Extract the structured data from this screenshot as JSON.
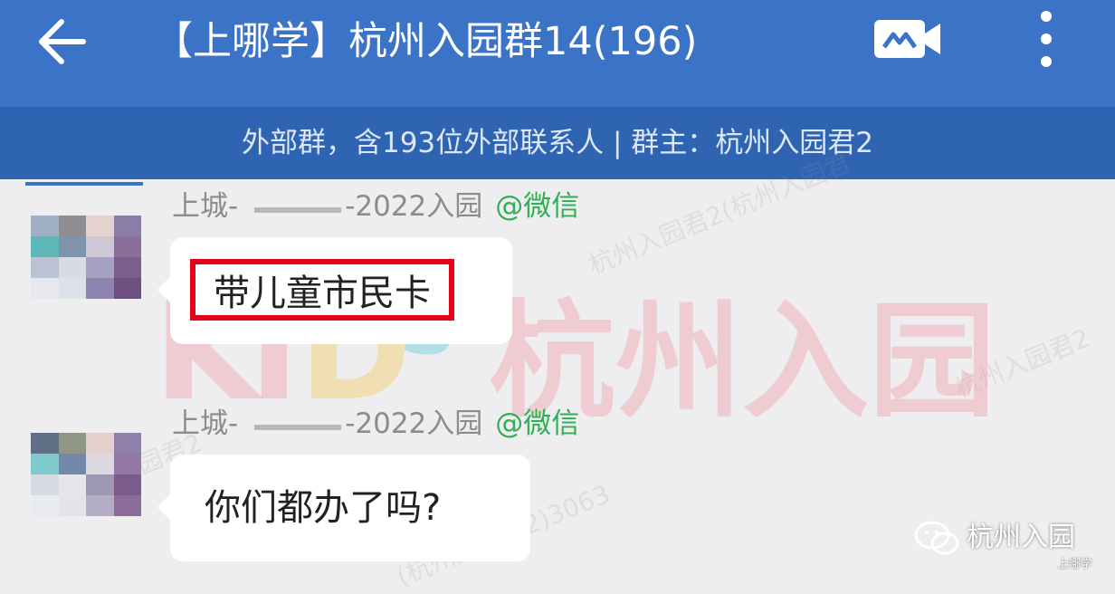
{
  "header": {
    "title": "【上哪学】杭州入园群14(196)",
    "back_icon": "arrow-left-icon",
    "video_icon": "video-call-icon",
    "more_icon": "more-vertical-icon"
  },
  "subheader": {
    "text": "外部群，含193位外部联系人 | 群主：杭州入园君2"
  },
  "watermark": {
    "logo_text": "KIDS",
    "main_text": "杭州入园",
    "faint_text_1": "杭州入园君2(杭州入园君",
    "faint_text_2": "杭州入园君2",
    "faint_text_3": "(杭州入园君2)3063",
    "faint_text_4": "园君2"
  },
  "messages": [
    {
      "sender_prefix": "上城-",
      "sender_suffix": "-2022入园",
      "source": "@微信",
      "text": "带儿童市民卡"
    },
    {
      "sender_prefix": "上城-",
      "sender_suffix": "-2022入园",
      "source": "@微信",
      "text": "你们都办了吗?"
    }
  ],
  "brand": {
    "name": "杭州入园",
    "sub": "上哪学",
    "icon": "wechat-icon"
  },
  "colors": {
    "header": "#3b74c6",
    "subheader": "#2f64b3",
    "highlight": "#e3061a",
    "source": "#2fae53"
  }
}
